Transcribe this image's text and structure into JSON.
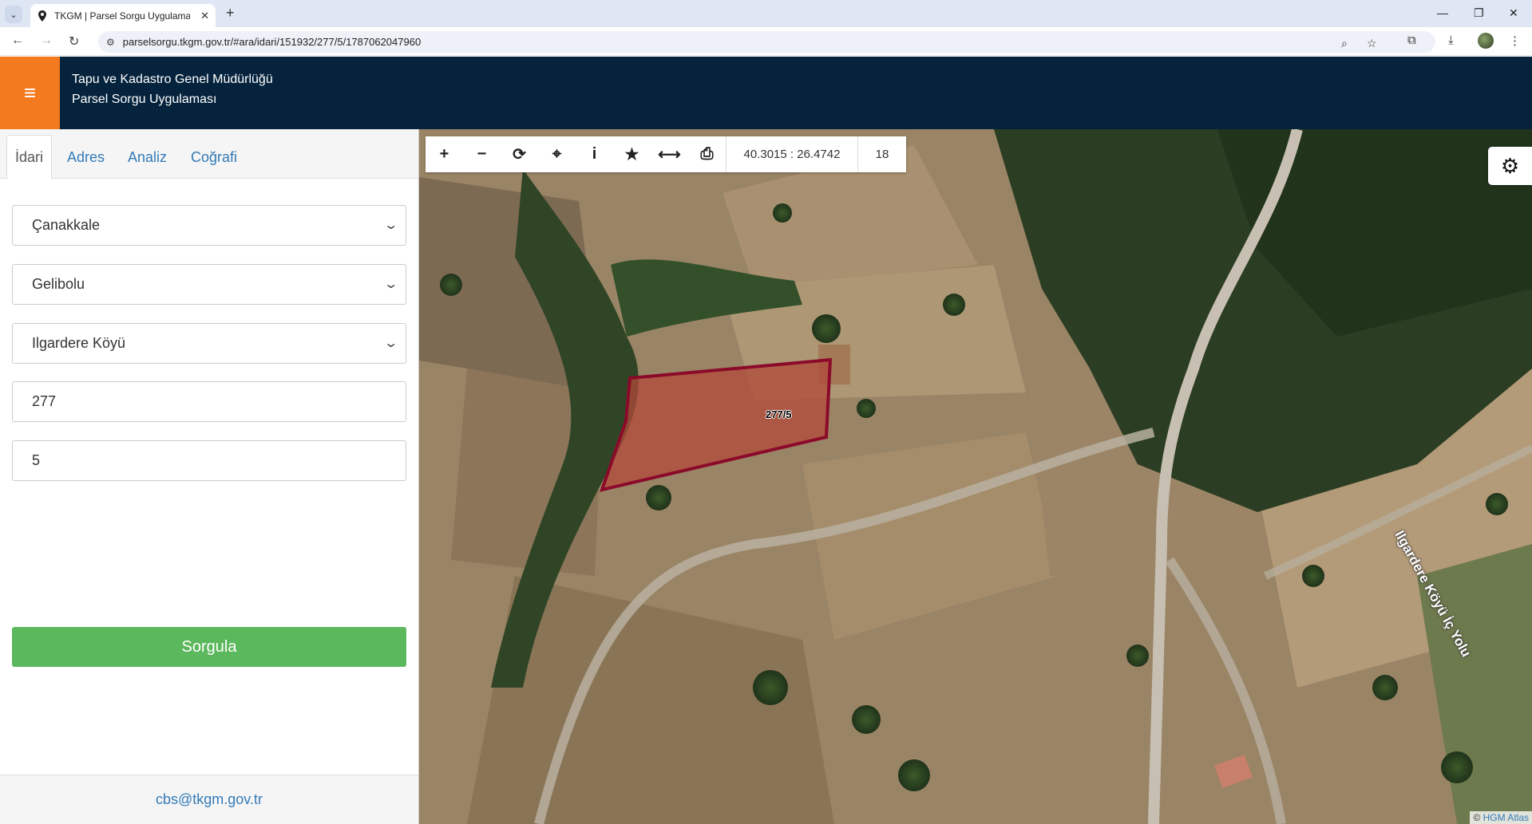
{
  "browser": {
    "tab_title": "TKGM | Parsel Sorgu Uygulaması",
    "url": "parselsorgu.tkgm.gov.tr/#ara/idari/151932/277/5/1787062047960"
  },
  "header": {
    "org_name": "Tapu ve Kadastro Genel Müdürlüğü",
    "app_name": "Parsel Sorgu Uygulaması"
  },
  "panel": {
    "tabs": [
      {
        "label": "İdari",
        "active": true
      },
      {
        "label": "Adres",
        "active": false
      },
      {
        "label": "Analiz",
        "active": false
      },
      {
        "label": "Coğrafi",
        "active": false
      }
    ],
    "province": "Çanakkale",
    "district": "Gelibolu",
    "neighborhood": "Ilgardere Köyü",
    "block_no": "277",
    "parcel_no": "5",
    "query_label": "Sorgula",
    "contact_email": "cbs@tkgm.gov.tr"
  },
  "map": {
    "coordinates": "40.3015 : 26.4742",
    "zoom_level": "18",
    "parcel_label": "277/5",
    "road_label": "Ilgardere Köyü İç Yolu",
    "attribution_prefix": "©",
    "attribution_link": "HGM Atlas",
    "parcel_fill": "#a33a2a",
    "parcel_stroke": "#8b0a2a"
  },
  "icons": {
    "menu": "hamburger-icon",
    "settings": "gear-icon",
    "toolbar": [
      "zoom-in-icon",
      "zoom-out-icon",
      "refresh-icon",
      "locate-icon",
      "info-icon",
      "star-icon",
      "measure-icon",
      "print-icon"
    ]
  },
  "colors": {
    "header_bg": "#05233d",
    "menu_bg": "#f47a20",
    "query_button": "#5cb85c",
    "link": "#337ab7"
  }
}
